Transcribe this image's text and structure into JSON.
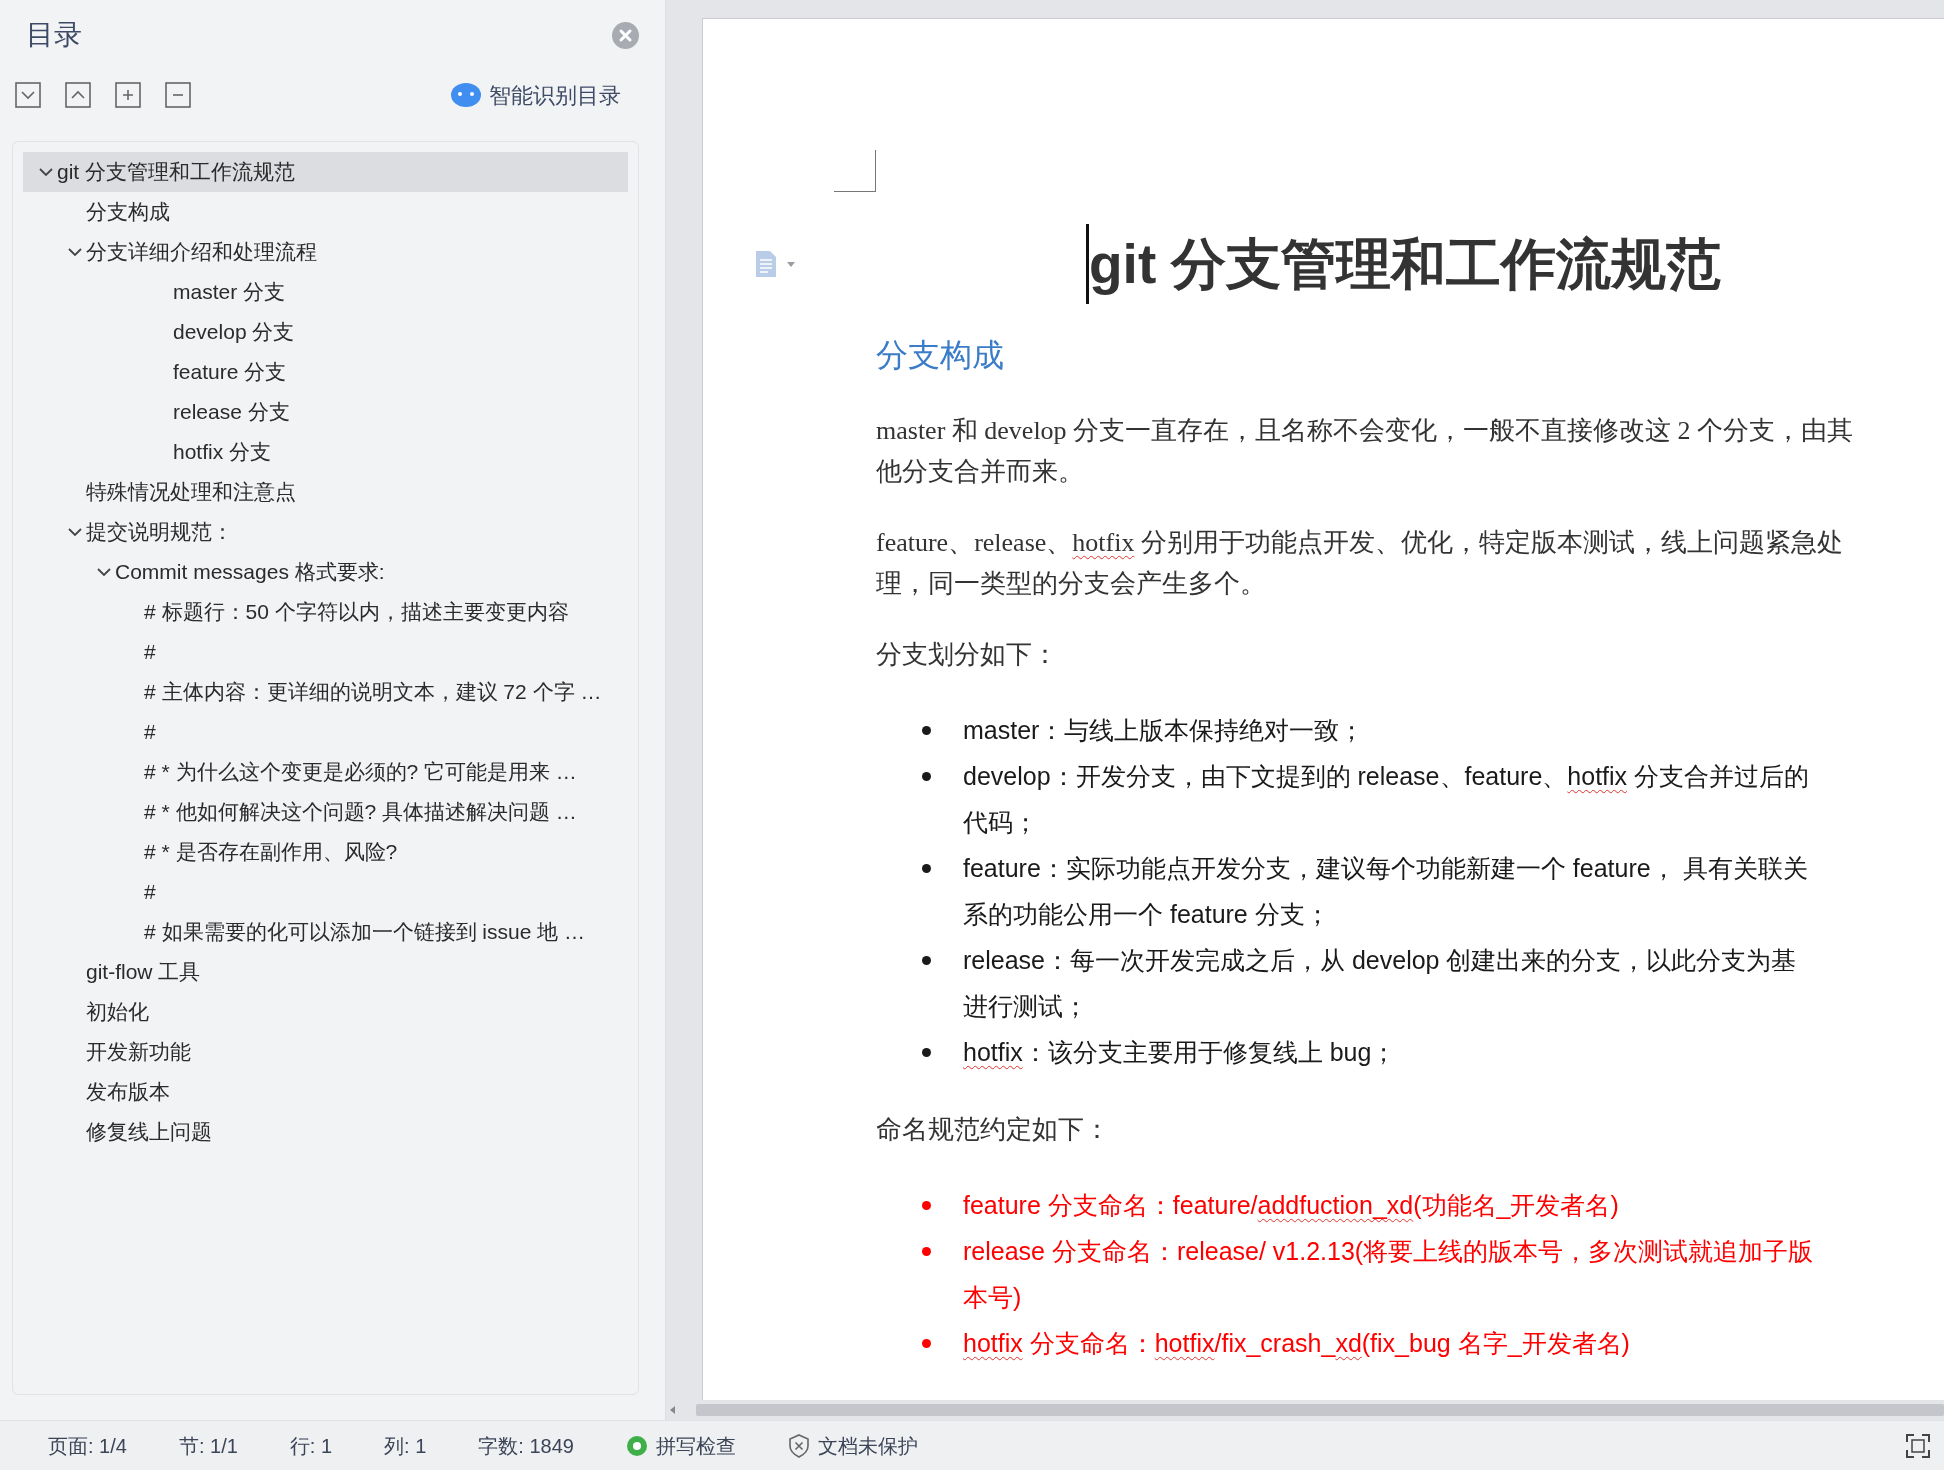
{
  "toc": {
    "title": "目录",
    "smart_button": "智能识别目录",
    "items": [
      {
        "label": "git 分支管理和工作流规范",
        "selected": true,
        "expanded": true,
        "children": [
          {
            "label": "分支构成",
            "selected": false
          },
          {
            "label": "分支详细介绍和处理流程",
            "selected": false,
            "expanded": true,
            "children": [
              {
                "children": [
                  {
                    "children": [
                      {
                        "label": "master 分支",
                        "selected": false
                      },
                      {
                        "label": "develop 分支",
                        "selected": false
                      },
                      {
                        "label": "feature 分支",
                        "selected": false
                      },
                      {
                        "label": "release 分支",
                        "selected": false
                      },
                      {
                        "label": "hotfix 分支",
                        "selected": false
                      }
                    ]
                  }
                ]
              }
            ]
          },
          {
            "label": "特殊情况处理和注意点",
            "selected": false
          },
          {
            "label": "提交说明规范：",
            "selected": false,
            "expanded": true,
            "children": [
              {
                "label": "Commit messages 格式要求:",
                "selected": false,
                "expanded": true,
                "children": [
                  {
                    "label": "# 标题行：50 个字符以内，描述主要变更内容",
                    "selected": false
                  },
                  {
                    "label": "#",
                    "selected": false
                  },
                  {
                    "label": "# 主体内容：更详细的说明文本，建议 72 个字 …",
                    "selected": false
                  },
                  {
                    "label": "#",
                    "selected": false
                  },
                  {
                    "label": "# * 为什么这个变更是必须的? 它可能是用来 …",
                    "selected": false
                  },
                  {
                    "label": "# * 他如何解决这个问题? 具体描述解决问题 …",
                    "selected": false
                  },
                  {
                    "label": "# * 是否存在副作用、风险?",
                    "selected": false
                  },
                  {
                    "label": "#",
                    "selected": false
                  },
                  {
                    "label": "# 如果需要的化可以添加一个链接到 issue 地 …",
                    "selected": false
                  }
                ]
              }
            ]
          },
          {
            "label": "git-flow 工具",
            "selected": false
          },
          {
            "label": "初始化",
            "selected": false
          },
          {
            "label": "开发新功能",
            "selected": false
          },
          {
            "label": "发布版本",
            "selected": false
          },
          {
            "label": "修复线上问题",
            "selected": false
          }
        ]
      }
    ]
  },
  "document": {
    "title": "git 分支管理和工作流规范",
    "blocks": [
      {
        "kind": "heading",
        "text": "分支构成"
      },
      {
        "kind": "paragraph",
        "lines": [
          "master 和 develop 分支一直存在，且名称不会变化，一般不直接修改这 2 个分支，由其",
          "他分支合并而来。"
        ]
      },
      {
        "kind": "paragraph",
        "lines": [
          {
            "runs": [
              {
                "text": "feature、release、",
                "misspelled": false
              },
              {
                "text": "hotfix",
                "misspelled": true
              },
              {
                "text": " 分别用于功能点开发、优化，特定版本测试，线上问题紧急处",
                "misspelled": false
              }
            ]
          },
          "理，同一类型的分支会产生多个。"
        ]
      },
      {
        "kind": "paragraph",
        "lines": [
          "分支划分如下："
        ]
      },
      {
        "kind": "bullets",
        "color": "#1a1a1a",
        "items": [
          {
            "lines": [
              "master：与线上版本保持绝对一致；"
            ]
          },
          {
            "lines": [
              {
                "runs": [
                  {
                    "text": "develop：开发分支，由下文提到的 release、feature、",
                    "misspelled": false
                  },
                  {
                    "text": "hotfix",
                    "misspelled": true
                  },
                  {
                    "text": " 分支合并过后的",
                    "misspelled": false
                  }
                ]
              },
              "代码；"
            ]
          },
          {
            "lines": [
              "feature：实际功能点开发分支，建议每个功能新建一个 feature，  具有关联关",
              "系的功能公用一个 feature 分支；"
            ]
          },
          {
            "lines": [
              "release：每一次开发完成之后，从 develop 创建出来的分支，以此分支为基",
              "进行测试；"
            ]
          },
          {
            "lines": [
              {
                "runs": [
                  {
                    "text": "hotfix",
                    "misspelled": true
                  },
                  {
                    "text": "：该分支主要用于修复线上 bug；",
                    "misspelled": false
                  }
                ]
              }
            ]
          }
        ]
      },
      {
        "kind": "paragraph",
        "lines": [
          "命名规范约定如下："
        ]
      },
      {
        "kind": "bullets",
        "color": "#ff0000",
        "items": [
          {
            "lines": [
              {
                "runs": [
                  {
                    "text": "feature 分支命名：feature/",
                    "misspelled": false
                  },
                  {
                    "text": "addfuction_xd",
                    "misspelled": true
                  },
                  {
                    "text": "(功能名_开发者名)",
                    "misspelled": false
                  }
                ]
              }
            ]
          },
          {
            "lines": [
              "release 分支命名：release/ v1.2.13(将要上线的版本号，多次测试就追加子版",
              "本号)"
            ]
          },
          {
            "lines": [
              {
                "runs": [
                  {
                    "text": "hotfix",
                    "misspelled": true
                  },
                  {
                    "text": " 分支命名：",
                    "misspelled": false
                  },
                  {
                    "text": "hotfix",
                    "misspelled": true
                  },
                  {
                    "text": "/fix_crash_",
                    "misspelled": false
                  },
                  {
                    "text": "xd",
                    "misspelled": true
                  },
                  {
                    "text": "(fix_bug 名字_开发者名)",
                    "misspelled": false
                  }
                ]
              }
            ]
          }
        ]
      }
    ]
  },
  "status_bar": [
    {
      "kind": "text",
      "text": "页面: 1/4"
    },
    {
      "kind": "text",
      "text": "节: 1/1"
    },
    {
      "kind": "text",
      "text": "行: 1"
    },
    {
      "kind": "text",
      "text": "列: 1"
    },
    {
      "kind": "text",
      "text": "字数: 1849"
    },
    {
      "kind": "spell-check",
      "text": "拼写检查",
      "on": true
    },
    {
      "kind": "protection",
      "text": "文档未保护"
    }
  ]
}
